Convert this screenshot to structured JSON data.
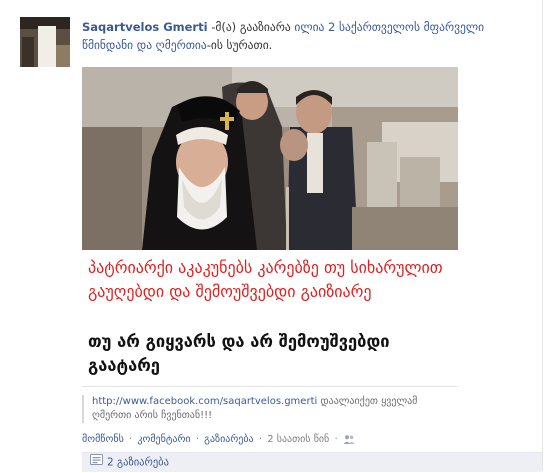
{
  "post": {
    "author": "Saqartvelos Gmerti",
    "shared_prefix": "-მ(ა) გააზიარა",
    "shared_link": "ილია 2 საქართველოს მფარველი წმინდანი და ღმერთია",
    "shared_suffix": "-ის სურათი."
  },
  "image_card": {
    "red_text": "პატრიარქი აკაკუნებს კარებზე თუ სიხარულით გაუღებდი და შემოუშვებდი გაიზიარე",
    "black_text": "თუ არ გიყვარს და არ შემოუშვებდი გაატარე"
  },
  "caption": {
    "url": "http://www.facebook.com/saqartvelos.gmerti",
    "text": "დაალაიქეთ ყველამ ღმერთი არის ჩვენთან!!!"
  },
  "actions": {
    "like": "მომწონს",
    "comment": "კომენტარი",
    "share": "გაზიარება",
    "sep": "·",
    "timestamp": "2 საათის წინ"
  },
  "share_bar": {
    "label": "2 გაზიარება"
  },
  "icons": {
    "audience": "friends-icon",
    "shares": "share-icon"
  },
  "colors": {
    "link": "#3b5998",
    "red_text": "#e02020",
    "share_bar_bg": "#edeff4"
  }
}
